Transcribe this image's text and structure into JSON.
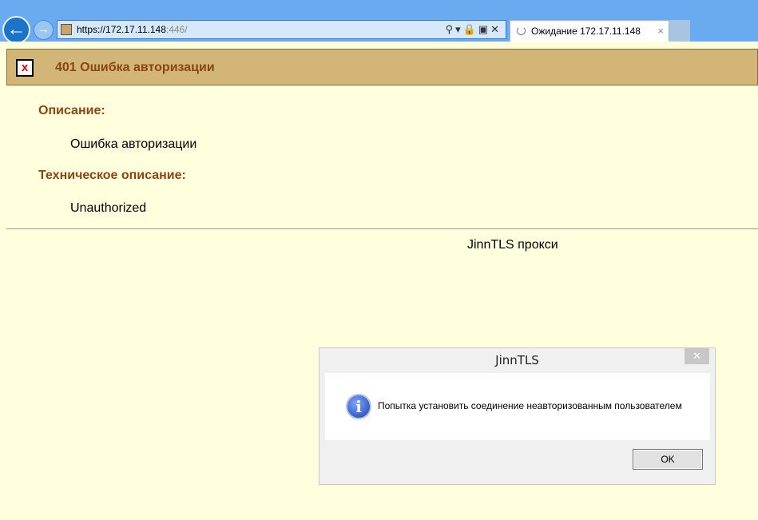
{
  "browser": {
    "url_host": "https://172.17.11.148",
    "url_port": ":446/",
    "tab_title": "Ожидание 172.17.11.148",
    "tab_close": "×",
    "icons": {
      "back": "←",
      "forward": "→",
      "address_tools": "⚲▾🔒▣✕"
    }
  },
  "page": {
    "title": "401 Ошибка авторизации",
    "error_icon": "x",
    "description_label": "Описание:",
    "description_value": "Ошибка авторизации",
    "tech_label": "Техническое описание:",
    "tech_value": "Unauthorized",
    "footer": "JinnTLS прокси"
  },
  "dialog": {
    "title": "JinnTLS",
    "close": "✕",
    "info_glyph": "i",
    "message": "Попытка установить соединение неавторизованным пользователем",
    "ok_label": "OK"
  }
}
